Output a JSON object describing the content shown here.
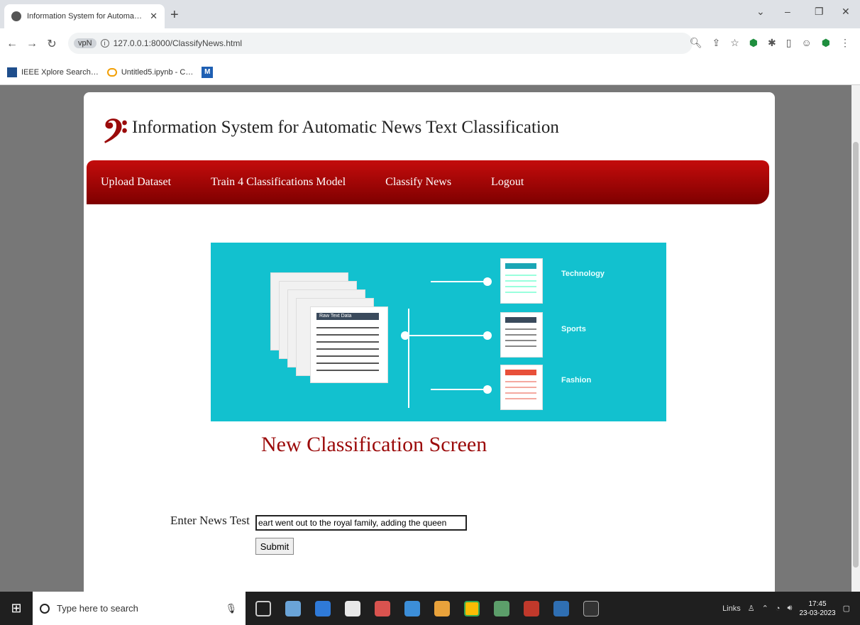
{
  "browser": {
    "tab_title": "Information System for Automa…",
    "url": "127.0.0.1:8000/ClassifyNews.html",
    "ext_badge": "vpN",
    "bookmarks": [
      "IEEE Xplore Search…",
      "Untitled5.ipynb - C…"
    ]
  },
  "site": {
    "logo_glyph": "𝄢",
    "title": "Information System for Automatic News Text Classification",
    "menu": [
      "Upload Dataset",
      "Train 4 Classifications Model",
      "Classify News",
      "Logout"
    ]
  },
  "banner": {
    "raw_label": "Raw Text Data",
    "categories": [
      "Technology",
      "Sports",
      "Fashion"
    ]
  },
  "form": {
    "screen_title": "New Classification Screen",
    "label": "Enter News Test",
    "input_value": "eart went out to the royal family, adding the queen",
    "submit_label": "Submit"
  },
  "taskbar": {
    "search_placeholder": "Type here to search",
    "links_label": "Links",
    "time": "17:45",
    "date": "23-03-2023"
  }
}
